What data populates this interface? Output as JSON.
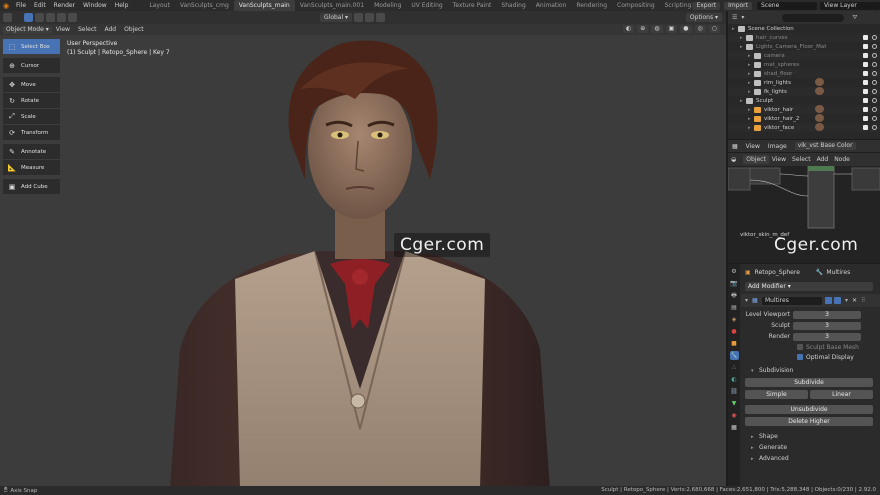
{
  "menubar": {
    "menus": [
      "File",
      "Edit",
      "Render",
      "Window",
      "Help"
    ],
    "workspaces": [
      "Layout",
      "VanSculpts_cmg",
      "VanSculpts_main",
      "VanSculpts_main.001",
      "Modeling",
      "UV Editing",
      "Texture Paint",
      "Shading",
      "Animation",
      "Rendering",
      "Compositing",
      "Scripting"
    ],
    "active_workspace": "VanSculpts_main",
    "export_label": "Export",
    "import_label": "Import",
    "scene_label": "Scene",
    "view_layer_label": "View Layer"
  },
  "viewport": {
    "mode": "Object Mode",
    "menus": [
      "View",
      "Select",
      "Add",
      "Object"
    ],
    "orientation": "Global",
    "options_label": "Options",
    "info_line1": "User Perspective",
    "info_line2": "(1) Sculpt | Retopo_Sphere | Key 7",
    "tools": [
      {
        "name": "select-box",
        "label": "Select Box",
        "icon": "select-box-icon",
        "active": true
      },
      {
        "name": "cursor",
        "label": "Cursor",
        "icon": "cursor-icon"
      },
      {
        "name": "move",
        "label": "Move",
        "icon": "move-icon"
      },
      {
        "name": "rotate",
        "label": "Rotate",
        "icon": "rotate-icon"
      },
      {
        "name": "scale",
        "label": "Scale",
        "icon": "scale-icon"
      },
      {
        "name": "transform",
        "label": "Transform",
        "icon": "transform-icon"
      },
      {
        "name": "annotate",
        "label": "Annotate",
        "icon": "annotate-icon"
      },
      {
        "name": "measure",
        "label": "Measure",
        "icon": "measure-icon"
      },
      {
        "name": "add-cube",
        "label": "Add Cube",
        "icon": "add-cube-icon"
      }
    ],
    "watermark": "Cger.com"
  },
  "outliner": {
    "rows": [
      {
        "label": "Scene Collection",
        "indent": 0,
        "type": "collection"
      },
      {
        "label": "hair_curves",
        "indent": 1,
        "type": "collection",
        "dim": true
      },
      {
        "label": "Lights_Camera_Floor_Mat",
        "indent": 1,
        "type": "collection",
        "dim": true
      },
      {
        "label": "camera",
        "indent": 2,
        "type": "collection",
        "dim": true
      },
      {
        "label": "mat_spheres",
        "indent": 2,
        "type": "collection",
        "dim": true
      },
      {
        "label": "shad_floor",
        "indent": 2,
        "type": "collection",
        "dim": true
      },
      {
        "label": "rim_lights",
        "indent": 2,
        "type": "collection",
        "avatar": true
      },
      {
        "label": "fk_lights",
        "indent": 2,
        "type": "collection",
        "avatar": true
      },
      {
        "label": "Sculpt",
        "indent": 1,
        "type": "collection"
      },
      {
        "label": "viktor_hair",
        "indent": 2,
        "type": "mesh",
        "avatar": true
      },
      {
        "label": "viktor_hair_2",
        "indent": 2,
        "type": "mesh",
        "avatar": true
      },
      {
        "label": "viktor_face",
        "indent": 2,
        "type": "mesh",
        "avatar": true
      }
    ]
  },
  "image_editor": {
    "menus": [
      "View",
      "Image"
    ],
    "image_name": "vik_vst Base Color"
  },
  "node_editor": {
    "object_label": "Object",
    "menus": [
      "View",
      "Select",
      "Add",
      "Node"
    ],
    "material_label": "viktor_skin_m_def",
    "watermark": "Cger.com"
  },
  "properties": {
    "object_name": "Retopo_Sphere",
    "modifier_type_label": "Multires",
    "add_modifier_label": "Add Modifier",
    "modifier_name": "Multires",
    "fields": [
      {
        "label": "Level Viewport",
        "value": "3"
      },
      {
        "label": "Sculpt",
        "value": "3"
      },
      {
        "label": "Render",
        "value": "3"
      }
    ],
    "sculpt_base_mesh_label": "Sculpt Base Mesh",
    "optimal_display_label": "Optimal Display",
    "subdivision_label": "Subdivision",
    "subdivide_label": "Subdivide",
    "simple_label": "Simple",
    "linear_label": "Linear",
    "unsubdivide_label": "Unsubdivide",
    "delete_higher_label": "Delete Higher",
    "shape_label": "Shape",
    "generate_label": "Generate",
    "advanced_label": "Advanced"
  },
  "statusbar": {
    "left": "Axis Snap",
    "right": "Sculpt | Retopo_Sphere | Verts:2,680,668 | Faces:2,651,800 | Tris:5,288,348 | Objects:0/230 | 2.92.0"
  },
  "colors": {
    "accent": "#4772b3",
    "background": "#3c3c3c",
    "panel": "#2b2b2b"
  }
}
